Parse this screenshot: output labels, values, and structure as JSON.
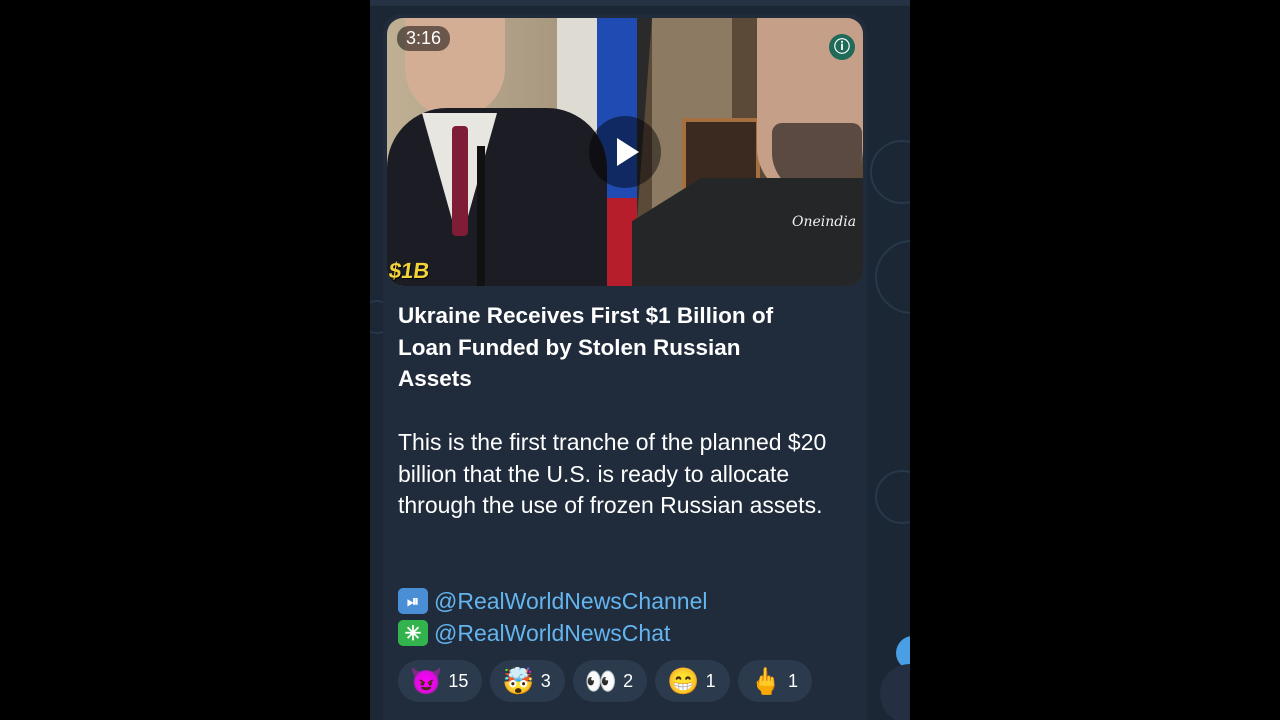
{
  "video": {
    "duration": "3:16",
    "overlay_text": "$1B",
    "watermark": "Oneindia"
  },
  "post": {
    "headline": "Ukraine Receives First $1 Billion of Loan Funded by Stolen Russian Assets",
    "body": "This is the first tranche of the planned $20 billion that the U.S. is ready to allocate through the use of frozen Russian assets.",
    "links": [
      {
        "icon": "play-pause-icon",
        "text": "@RealWorldNewsChannel"
      },
      {
        "icon": "asterisk-icon",
        "text": "@RealWorldNewsChat"
      }
    ]
  },
  "reactions": [
    {
      "emoji": "😈",
      "count": "15"
    },
    {
      "emoji": "🤯",
      "count": "3"
    },
    {
      "emoji": "👀",
      "count": "2"
    },
    {
      "emoji": "😁",
      "count": "1"
    },
    {
      "emoji": "🖕",
      "count": "1"
    }
  ],
  "colors": {
    "background": "#1b2734",
    "bubble": "#202c3b",
    "link": "#64b5ef",
    "chip": "#2b3a4c"
  }
}
